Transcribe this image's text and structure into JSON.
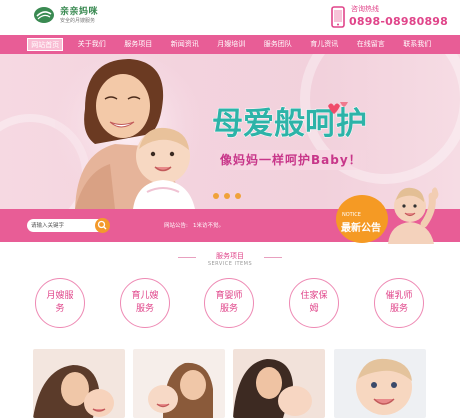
{
  "header": {
    "logo_title": "亲亲妈咪",
    "logo_subtitle": "安全的月嫂服务",
    "hotline_label": "咨询热线",
    "hotline_number": "0898-08980898"
  },
  "nav": {
    "items": [
      {
        "label": "网站首页",
        "active": true
      },
      {
        "label": "关于我们",
        "active": false
      },
      {
        "label": "服务项目",
        "active": false
      },
      {
        "label": "新闻资讯",
        "active": false
      },
      {
        "label": "月嫂培训",
        "active": false
      },
      {
        "label": "服务团队",
        "active": false
      },
      {
        "label": "育儿资讯",
        "active": false
      },
      {
        "label": "在线留言",
        "active": false
      },
      {
        "label": "联系我们",
        "active": false
      }
    ]
  },
  "banner": {
    "title": "母爱般呵护",
    "subtitle": "像妈妈一样呵护Baby！",
    "slide_count": 3
  },
  "search": {
    "placeholder": "请输入关键字"
  },
  "notice": {
    "label": "网站公告:",
    "text": "1米访不觉。",
    "badge_en": "NOTICE",
    "badge_cn": "最新公告"
  },
  "services": {
    "title": "服务项目",
    "subtitle": "SERVICE ITEMS",
    "items": [
      {
        "label": "月嫂服务"
      },
      {
        "label": "育儿嫂服务"
      },
      {
        "label": "育婴师服务"
      },
      {
        "label": "住家保姆"
      },
      {
        "label": "催乳师服务"
      }
    ]
  },
  "colors": {
    "brand_pink": "#e85d96",
    "accent_orange": "#f39a2c",
    "logo_green": "#3a8a52"
  },
  "icons": [
    "logo-leaf-icon",
    "phone-icon",
    "search-icon"
  ]
}
